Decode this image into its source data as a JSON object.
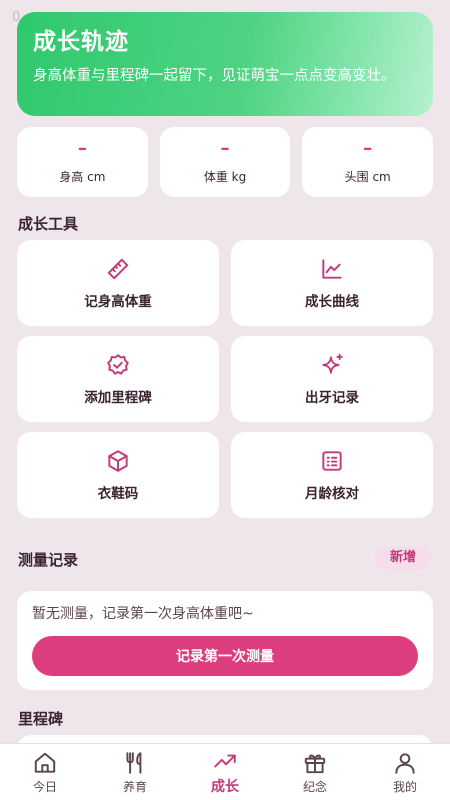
{
  "status_bar": {
    "time": "0"
  },
  "hero": {
    "title": "成长轨迹",
    "subtitle": "身高体重与里程碑一起留下，见证萌宝一点点变高变壮。",
    "gradient": [
      "#2fc86d",
      "#b8f0cf"
    ]
  },
  "stats": [
    {
      "value": "–",
      "label": "身高 cm"
    },
    {
      "value": "–",
      "label": "体重 kg"
    },
    {
      "value": "–",
      "label": "头围 cm"
    }
  ],
  "tools_section": {
    "title": "成长工具",
    "items": [
      {
        "label": "记身高体重",
        "icon": "ruler-icon"
      },
      {
        "label": "成长曲线",
        "icon": "line-chart-icon"
      },
      {
        "label": "添加里程碑",
        "icon": "badge-check-icon"
      },
      {
        "label": "出牙记录",
        "icon": "sparkle-icon"
      },
      {
        "label": "衣鞋码",
        "icon": "box-icon"
      },
      {
        "label": "月龄核对",
        "icon": "calendar-list-icon"
      }
    ]
  },
  "records_section": {
    "title": "测量记录",
    "add_label": "新增",
    "empty_text": "暂无测量，记录第一次身高体重吧~",
    "cta_label": "记录第一次测量"
  },
  "milestones_section": {
    "title": "里程碑"
  },
  "tabbar": {
    "items": [
      {
        "label": "今日",
        "icon": "home-icon",
        "active": false
      },
      {
        "label": "养育",
        "icon": "utensils-icon",
        "active": false
      },
      {
        "label": "成长",
        "icon": "trend-up-icon",
        "active": true
      },
      {
        "label": "纪念",
        "icon": "gift-icon",
        "active": false
      },
      {
        "label": "我的",
        "icon": "user-icon",
        "active": false
      }
    ]
  },
  "colors": {
    "accent": "#dc3d7e",
    "icon": "#c13a7a",
    "background": "#efe6ec",
    "card": "#ffffff"
  }
}
